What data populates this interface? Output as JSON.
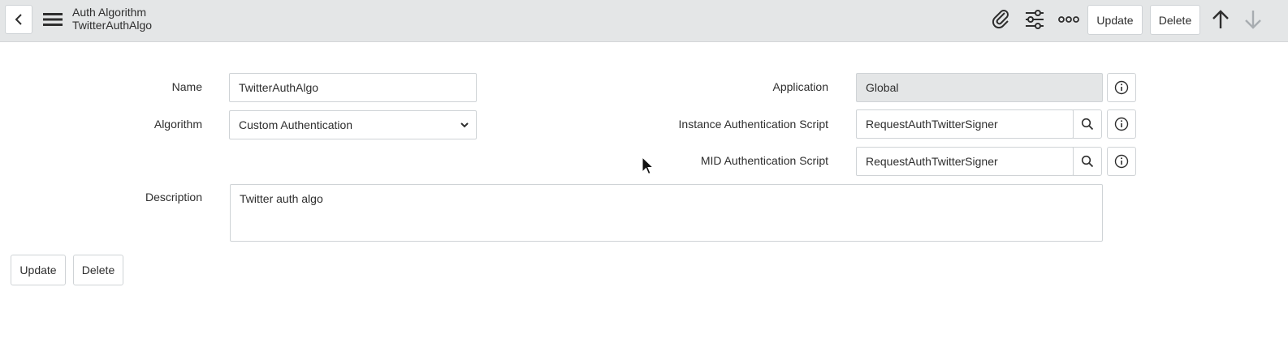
{
  "header": {
    "title": "Auth Algorithm",
    "subtitle": "TwitterAuthAlgo",
    "update_label": "Update",
    "delete_label": "Delete"
  },
  "form": {
    "name_label": "Name",
    "name_value": "TwitterAuthAlgo",
    "algorithm_label": "Algorithm",
    "algorithm_value": "Custom Authentication",
    "application_label": "Application",
    "application_value": "Global",
    "instance_script_label": "Instance Authentication Script",
    "instance_script_value": "RequestAuthTwitterSigner",
    "mid_script_label": "MID Authentication Script",
    "mid_script_value": "RequestAuthTwitterSigner",
    "description_label": "Description",
    "description_value": "Twitter auth algo"
  },
  "footer": {
    "update_label": "Update",
    "delete_label": "Delete"
  },
  "icons": {
    "back": "chevron-left-icon",
    "menu": "hamburger-icon",
    "attachment": "paperclip-icon",
    "personalize": "sliders-icon",
    "more": "more-options-icon",
    "prev": "arrow-up-icon",
    "next": "arrow-down-icon",
    "search": "search-icon",
    "info": "info-icon"
  }
}
